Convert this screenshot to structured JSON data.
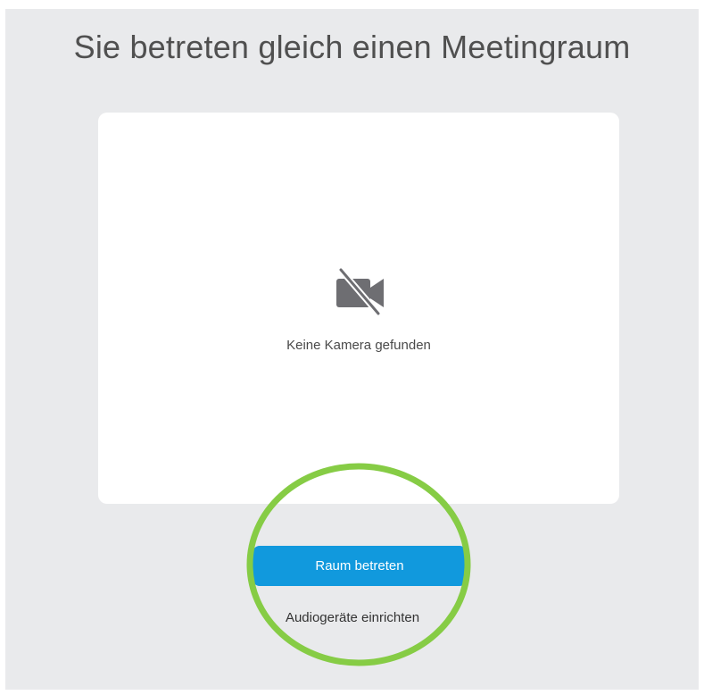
{
  "page": {
    "title": "Sie betreten gleich einen Meetingraum"
  },
  "preview": {
    "icon": "camera-off-icon",
    "message": "Keine Kamera gefunden"
  },
  "actions": {
    "join_label": "Raum betreten",
    "audio_setup_label": "Audiogeräte einrichten"
  },
  "colors": {
    "background": "#e9eaec",
    "card": "#ffffff",
    "button": "#1199dd",
    "icon": "#6e6e72",
    "highlight_ring": "#86cc45"
  }
}
